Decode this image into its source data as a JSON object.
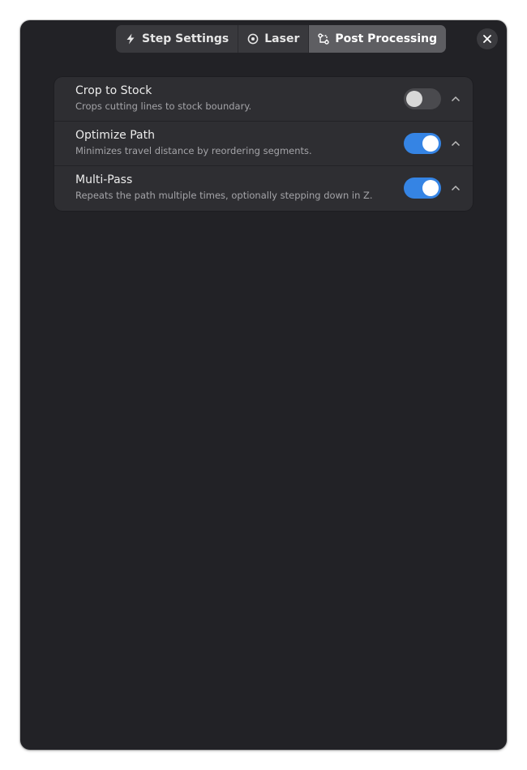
{
  "tabs": [
    {
      "label": "Step Settings",
      "icon": "lightning-icon",
      "active": false
    },
    {
      "label": "Laser",
      "icon": "target-icon",
      "active": false
    },
    {
      "label": "Post Processing",
      "icon": "flow-icon",
      "active": true
    }
  ],
  "close_icon": "close-icon",
  "rows": [
    {
      "title": "Crop to Stock",
      "subtitle": "Crops cutting lines to stock boundary.",
      "enabled": false
    },
    {
      "title": "Optimize Path",
      "subtitle": "Minimizes travel distance by reordering segments.",
      "enabled": true
    },
    {
      "title": "Multi-Pass",
      "subtitle": "Repeats the path multiple times, optionally stepping down in Z.",
      "enabled": true
    }
  ],
  "colors": {
    "window_bg": "#222226",
    "card_bg": "#2e2e32",
    "accent": "#3584e4"
  }
}
